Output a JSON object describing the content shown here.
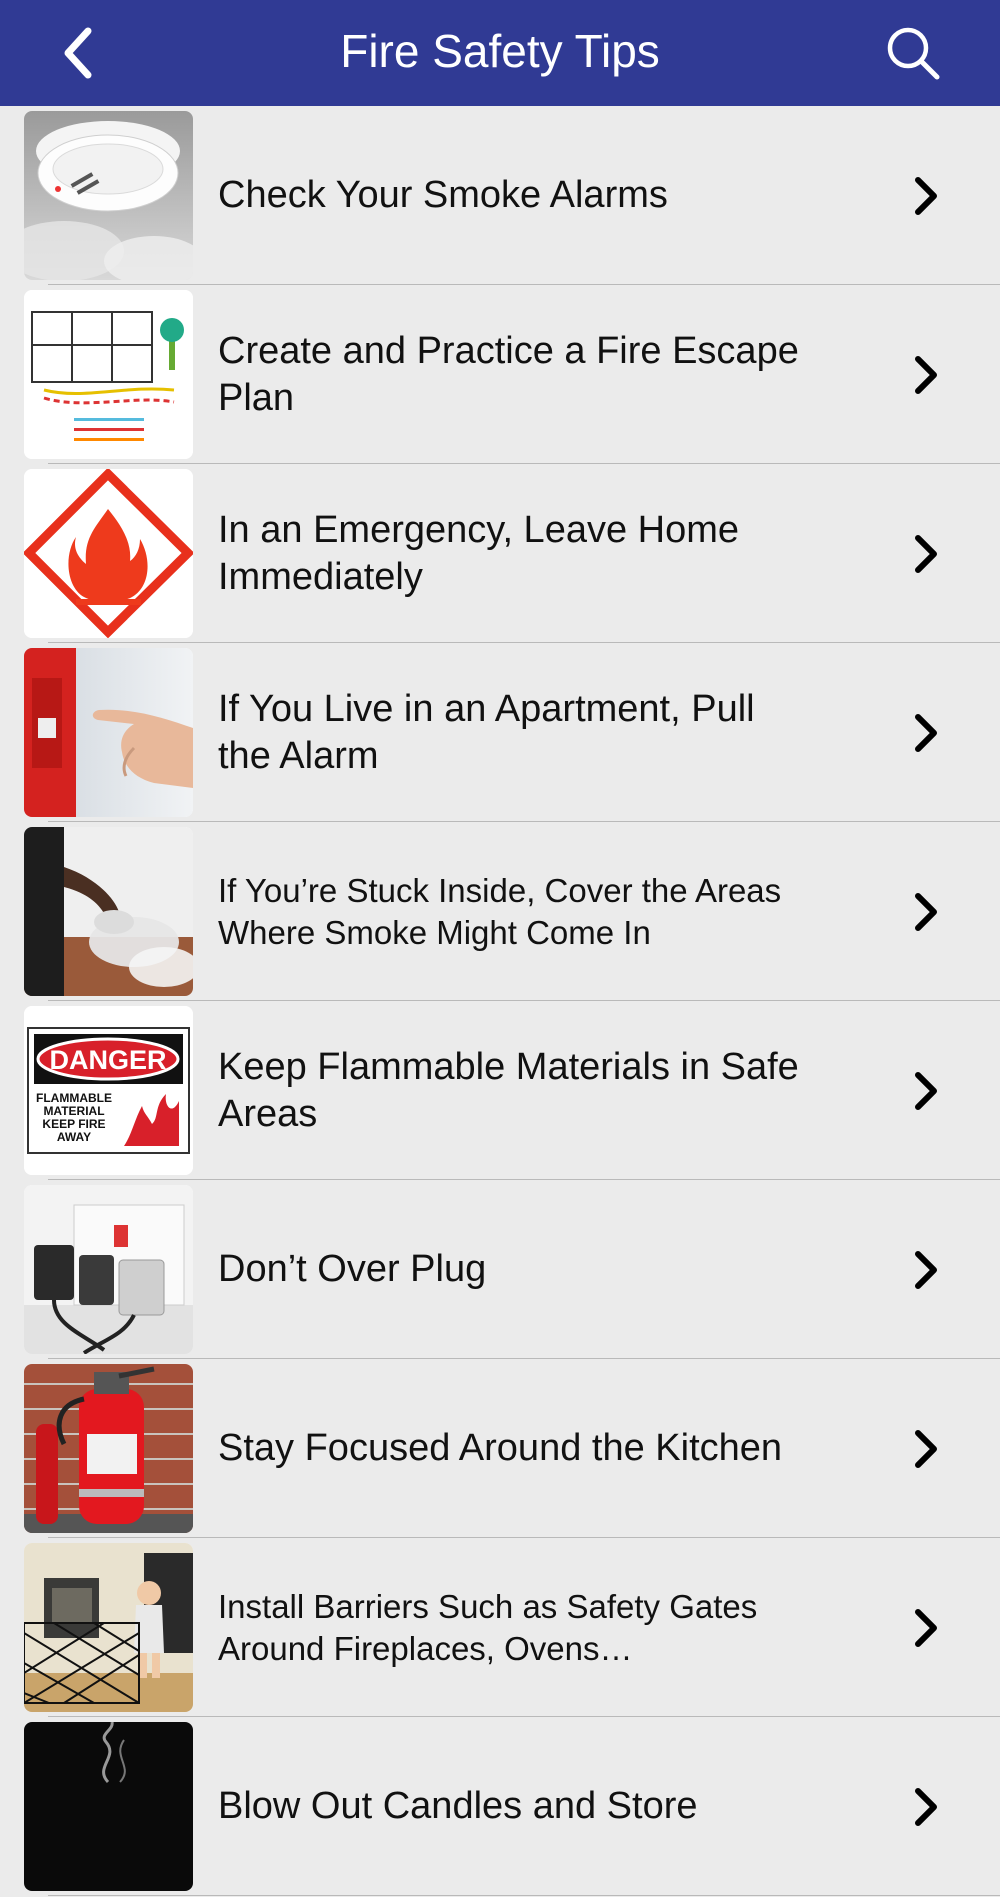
{
  "header": {
    "title": "Fire Safety Tips",
    "back_icon": "chevron-left-icon",
    "search_icon": "search-icon",
    "background_color": "#303a94"
  },
  "tips": [
    {
      "label": "Check Your Smoke Alarms",
      "thumbnail": "smoke-alarm-photo"
    },
    {
      "label": "Create and Practice a Fire Escape Plan",
      "thumbnail": "escape-plan-map"
    },
    {
      "label": "In an Emergency, Leave Home Immediately",
      "thumbnail": "flammable-warning-sign"
    },
    {
      "label": "If You Live in an Apartment, Pull the Alarm",
      "thumbnail": "fire-alarm-pull-photo"
    },
    {
      "label": "If You’re Stuck Inside, Cover the Areas Where Smoke Might Come In",
      "thumbnail": "smoke-under-door-photo"
    },
    {
      "label": "Keep Flammable Materials in Safe Areas",
      "thumbnail": "danger-flammable-sign",
      "sign_text": [
        "DANGER",
        "FLAMMABLE",
        "MATERIAL",
        "KEEP FIRE",
        "AWAY"
      ]
    },
    {
      "label": "Don’t Over Plug",
      "thumbnail": "overloaded-outlet-photo"
    },
    {
      "label": "Stay Focused Around the Kitchen",
      "thumbnail": "fire-extinguisher-photo"
    },
    {
      "label": "Install Barriers Such as Safety Gates Around Fireplaces, Ovens…",
      "thumbnail": "fireplace-gate-photo"
    },
    {
      "label": "Blow Out Candles and Store",
      "thumbnail": "candle-smoke-photo"
    }
  ],
  "row_chevron_icon": "chevron-right-icon"
}
